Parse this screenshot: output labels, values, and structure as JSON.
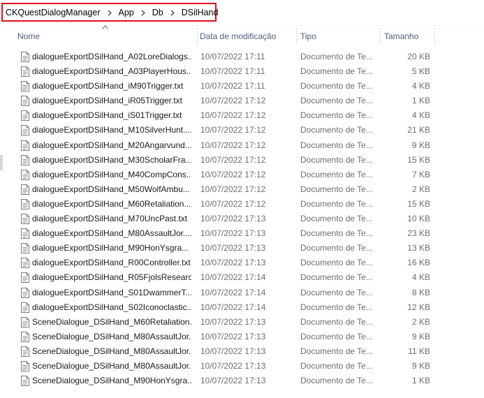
{
  "address": {
    "breadcrumbs": [
      "CKQuestDialogManager",
      "App",
      "Db",
      "DSilHand"
    ],
    "highlight_color": "#e0111b"
  },
  "columns": {
    "name": "Nome",
    "date": "Data de modificação",
    "type": "Tipo",
    "size": "Tamanho",
    "sorted_by": "name",
    "sort_icon": "chevron-up-icon"
  },
  "files": [
    {
      "name": "dialogueExportDSilHand_A02LoreDialogs...",
      "date": "10/07/2022 17:11",
      "type": "Documento de Te...",
      "size": "20 KB"
    },
    {
      "name": "dialogueExportDSilHand_A03PlayerHous...",
      "date": "10/07/2022 17:11",
      "type": "Documento de Te...",
      "size": "5 KB"
    },
    {
      "name": "dialogueExportDSilHand_iM90Trigger.txt",
      "date": "10/07/2022 17:11",
      "type": "Documento de Te...",
      "size": "4 KB"
    },
    {
      "name": "dialogueExportDSilHand_iR05Trigger.txt",
      "date": "10/07/2022 17:12",
      "type": "Documento de Te...",
      "size": "1 KB"
    },
    {
      "name": "dialogueExportDSilHand_iS01Trigger.txt",
      "date": "10/07/2022 17:12",
      "type": "Documento de Te...",
      "size": "4 KB"
    },
    {
      "name": "dialogueExportDSilHand_M10SilverHunt....",
      "date": "10/07/2022 17:12",
      "type": "Documento de Te...",
      "size": "21 KB"
    },
    {
      "name": "dialogueExportDSilHand_M20Angarvund...",
      "date": "10/07/2022 17:12",
      "type": "Documento de Te...",
      "size": "9 KB"
    },
    {
      "name": "dialogueExportDSilHand_M30ScholarFra...",
      "date": "10/07/2022 17:12",
      "type": "Documento de Te...",
      "size": "15 KB"
    },
    {
      "name": "dialogueExportDSilHand_M40CompCons...",
      "date": "10/07/2022 17:12",
      "type": "Documento de Te...",
      "size": "7 KB"
    },
    {
      "name": "dialogueExportDSilHand_M50WolfAmbu...",
      "date": "10/07/2022 17:12",
      "type": "Documento de Te...",
      "size": "2 KB"
    },
    {
      "name": "dialogueExportDSilHand_M60Retaliation....",
      "date": "10/07/2022 17:12",
      "type": "Documento de Te...",
      "size": "15 KB"
    },
    {
      "name": "dialogueExportDSilHand_M70UncPast.txt",
      "date": "10/07/2022 17:13",
      "type": "Documento de Te...",
      "size": "10 KB"
    },
    {
      "name": "dialogueExportDSilHand_M80AssaultJor....",
      "date": "10/07/2022 17:13",
      "type": "Documento de Te...",
      "size": "23 KB"
    },
    {
      "name": "dialogueExportDSilHand_M90HonYsgra...",
      "date": "10/07/2022 17:13",
      "type": "Documento de Te...",
      "size": "13 KB"
    },
    {
      "name": "dialogueExportDSilHand_R00Controller.txt",
      "date": "10/07/2022 17:13",
      "type": "Documento de Te...",
      "size": "16 KB"
    },
    {
      "name": "dialogueExportDSilHand_R05FjolsResearc...",
      "date": "10/07/2022 17:14",
      "type": "Documento de Te...",
      "size": "4 KB"
    },
    {
      "name": "dialogueExportDSilHand_S01DwammerT...",
      "date": "10/07/2022 17:14",
      "type": "Documento de Te...",
      "size": "8 KB"
    },
    {
      "name": "dialogueExportDSilHand_S02Iconoclastic....",
      "date": "10/07/2022 17:14",
      "type": "Documento de Te...",
      "size": "12 KB"
    },
    {
      "name": "SceneDialogue_DSilHand_M60Retaliation....",
      "date": "10/07/2022 17:13",
      "type": "Documento de Te...",
      "size": "2 KB"
    },
    {
      "name": "SceneDialogue_DSilHand_M80AssaultJor....",
      "date": "10/07/2022 17:13",
      "type": "Documento de Te...",
      "size": "9 KB"
    },
    {
      "name": "SceneDialogue_DSilHand_M80AssaultJor....",
      "date": "10/07/2022 17:13",
      "type": "Documento de Te...",
      "size": "11 KB"
    },
    {
      "name": "SceneDialogue_DSilHand_M80AssaultJor....",
      "date": "10/07/2022 17:13",
      "type": "Documento de Te...",
      "size": "9 KB"
    },
    {
      "name": "SceneDialogue_DSilHand_M90HonYsgra...",
      "date": "10/07/2022 17:13",
      "type": "Documento de Te...",
      "size": "1 KB"
    }
  ]
}
